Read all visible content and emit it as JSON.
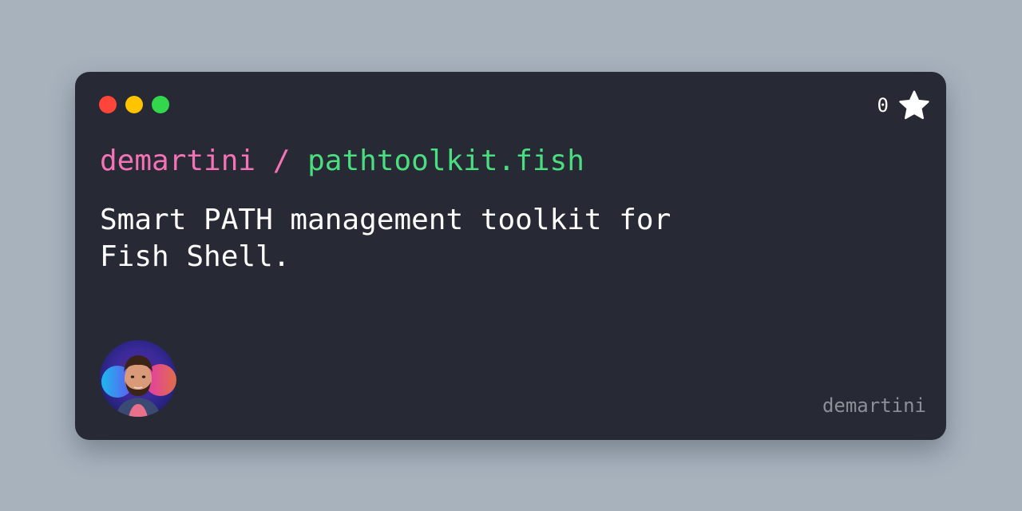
{
  "window": {
    "controls": [
      {
        "name": "close",
        "color": "#ff453a"
      },
      {
        "name": "minimize",
        "color": "#ffc300"
      },
      {
        "name": "maximize",
        "color": "#32d74b"
      }
    ]
  },
  "repo": {
    "owner": "demartini",
    "separator": " / ",
    "name": "pathtoolkit.fish",
    "owner_color": "#f472b6",
    "name_color": "#4ade80"
  },
  "description": "Smart PATH management toolkit for Fish Shell.",
  "stars": {
    "count": "0",
    "icon": "star-icon"
  },
  "author": {
    "username": "demartini",
    "avatar_icon": "avatar-portrait"
  },
  "colors": {
    "background": "#a7b2bd",
    "card": "#272935",
    "text": "#ffffff",
    "muted": "#8c8f98"
  }
}
